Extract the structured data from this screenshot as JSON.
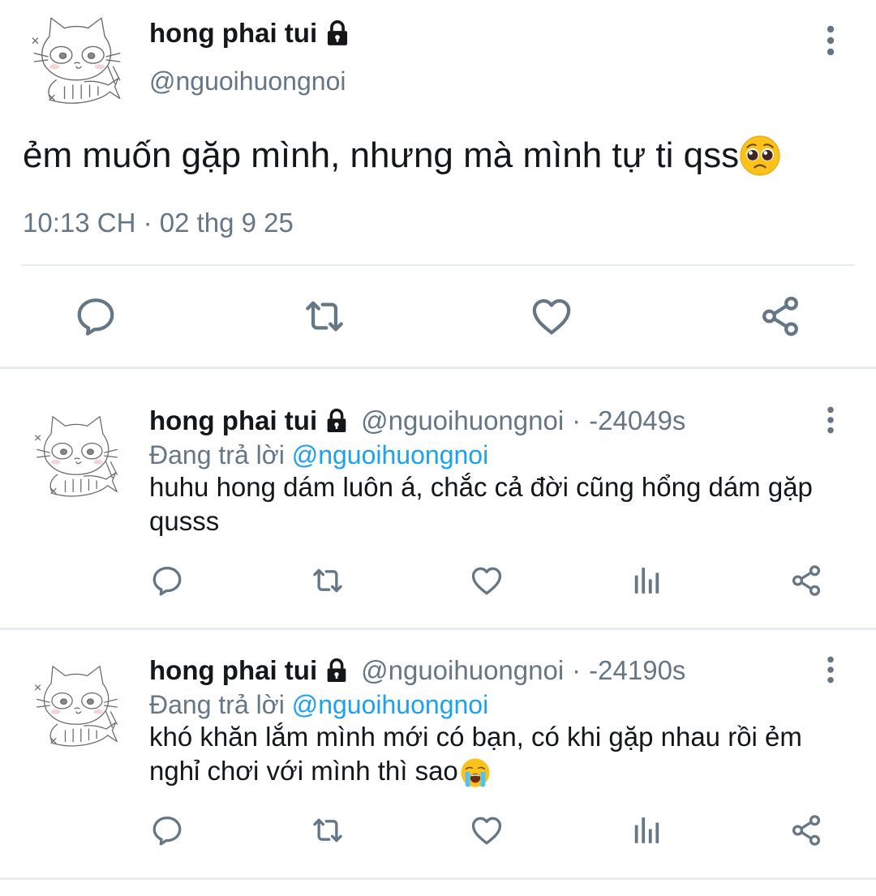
{
  "main_tweet": {
    "author_name": "hong phai tui",
    "handle": "@nguoihuongnoi",
    "text": "ẻm muốn gặp mình, nhưng mà mình tự ti qss",
    "emoji": "pleading-face",
    "timestamp": "10:13 CH · 02 thg 9 25",
    "actions": [
      "reply-icon",
      "retweet-icon",
      "like-icon",
      "share-icon"
    ]
  },
  "replies": [
    {
      "author_name": "hong phai tui",
      "handle": "@nguoihuongnoi",
      "dot": "·",
      "time": "-24049s",
      "replying_label": "Đang trả lời",
      "replying_to": "@nguoihuongnoi",
      "text": "huhu hong dám luôn á, chắc cả đời cũng hổng dám gặp qusss",
      "actions": [
        "reply-icon",
        "retweet-icon",
        "like-icon",
        "analytics-icon",
        "share-icon"
      ]
    },
    {
      "author_name": "hong phai tui",
      "handle": "@nguoihuongnoi",
      "dot": "·",
      "time": "-24190s",
      "replying_label": "Đang trả lời",
      "replying_to": "@nguoihuongnoi",
      "text": "khó khăn lắm mình mới có bạn, có khi gặp nhau rồi ẻm nghỉ chơi với mình thì sao",
      "emoji": "loudly-crying-face",
      "actions": [
        "reply-icon",
        "retweet-icon",
        "like-icon",
        "analytics-icon",
        "share-icon"
      ]
    }
  ],
  "colors": {
    "text_primary": "#14171a",
    "text_secondary": "#657786",
    "link": "#1da1f2",
    "icon": "#657786",
    "divider": "#e6ecf0"
  }
}
